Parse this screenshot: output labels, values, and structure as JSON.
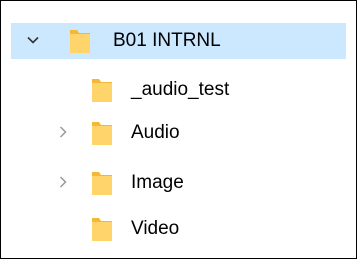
{
  "tree": {
    "root": {
      "label": "B01 INTRNL",
      "expanded": true,
      "selected": true,
      "expander_icon": "chevron-down-icon",
      "icon": "folder-icon"
    },
    "children": [
      {
        "label": "_audio_test",
        "has_children": false,
        "icon": "folder-icon"
      },
      {
        "label": "Audio",
        "has_children": true,
        "expander_icon": "chevron-right-icon",
        "icon": "folder-icon"
      },
      {
        "label": "Image",
        "has_children": true,
        "expander_icon": "chevron-right-icon",
        "icon": "folder-icon"
      },
      {
        "label": "Video",
        "has_children": false,
        "icon": "folder-icon"
      }
    ]
  },
  "colors": {
    "selection": "#cce8ff",
    "folder_body": "#ffd46b",
    "folder_tab": "#f2b836",
    "chevron_expanded": "#333333",
    "chevron_collapsed": "#9a9a9a",
    "border": "#000000"
  }
}
